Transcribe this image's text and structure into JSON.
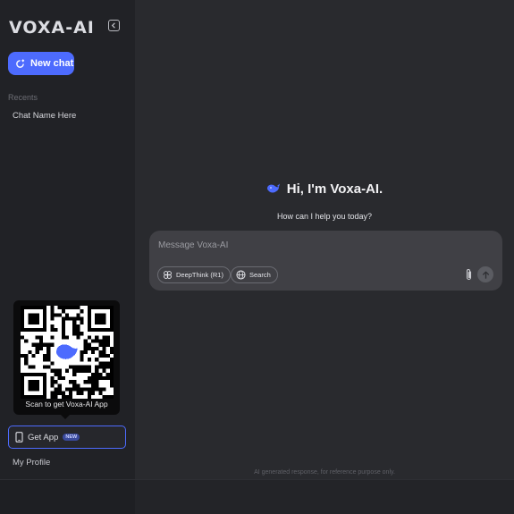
{
  "sidebar": {
    "logo": "VOXA-AI",
    "new_chat_label": "New chat",
    "recents_label": "Recents",
    "chats": [
      "Chat Name Here"
    ],
    "qr_caption": "Scan to get Voxa-AI App",
    "get_app_label": "Get App",
    "new_badge": "NEW",
    "profile_label": "My Profile"
  },
  "main": {
    "greeting": "Hi, I'm Voxa-AI.",
    "subtitle": "How can I help you today?",
    "input_placeholder": "Message Voxa-AI",
    "deepthink_label": "DeepThink (R1)",
    "search_label": "Search",
    "disclaimer": "AI generated response, for reference purpose only."
  },
  "colors": {
    "accent": "#4d6bfe",
    "sidebar_bg": "#212226",
    "main_bg": "#292a2e",
    "input_bg": "#404045"
  },
  "icons": [
    "collapse-sidebar-icon",
    "new-chat-icon",
    "whale-logo-icon",
    "deepthink-icon",
    "globe-icon",
    "paperclip-icon",
    "arrow-up-icon",
    "phone-icon"
  ]
}
